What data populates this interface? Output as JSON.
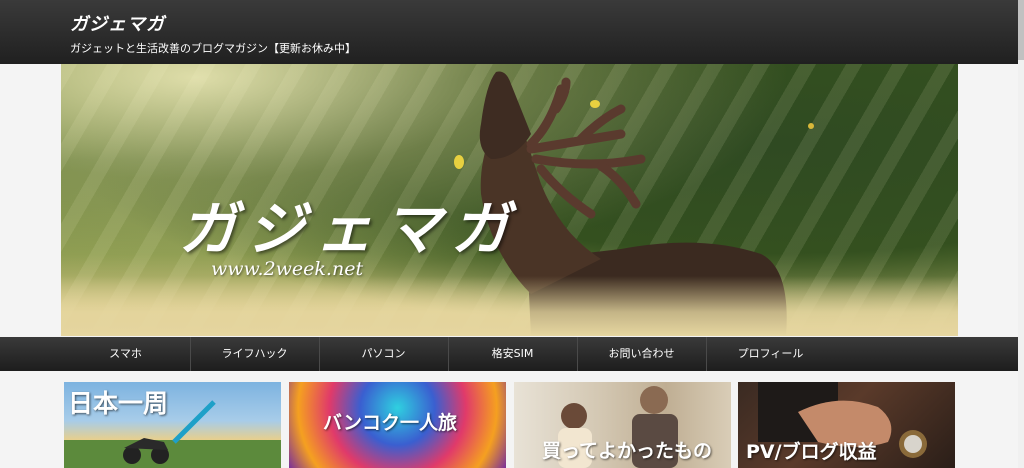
{
  "header": {
    "site_title": "ガジェマガ",
    "tagline": "ガジェットと生活改善のブログマガジン【更新お休み中】"
  },
  "hero": {
    "title": "ガジェマガ",
    "url": "www.2week.net"
  },
  "nav": {
    "items": [
      {
        "label": "スマホ"
      },
      {
        "label": "ライフハック"
      },
      {
        "label": "パソコン"
      },
      {
        "label": "格安SIM"
      },
      {
        "label": "お問い合わせ"
      },
      {
        "label": "プロフィール"
      }
    ]
  },
  "cards": [
    {
      "label": "日本一周"
    },
    {
      "label": "バンコク一人旅"
    },
    {
      "label": "買ってよかったもの"
    },
    {
      "label": "PV/ブログ収益"
    }
  ],
  "colors": {
    "header_bg": "#2a2a2a",
    "nav_bg": "#262626",
    "page_bg": "#f4f4f4"
  }
}
